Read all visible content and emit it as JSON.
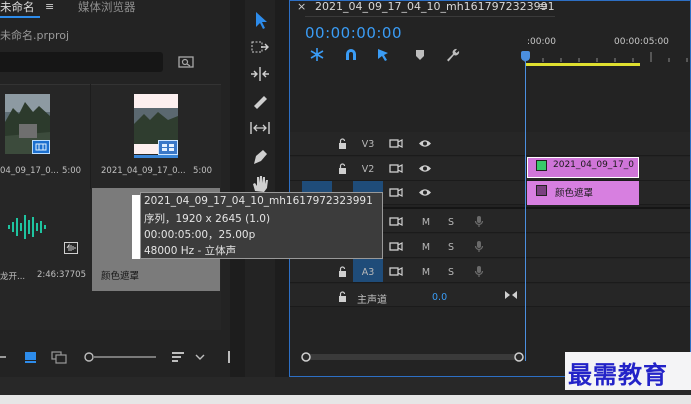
{
  "project_panel": {
    "tab_active": "未命名",
    "tab_menu_icon": "hamburger-icon",
    "tab_media": "媒体浏览器",
    "project_file": "未命名.prproj",
    "items": [
      {
        "name": "04_09_17_0...",
        "duration": "5:00"
      },
      {
        "name": "2021_04_09_17_0...",
        "duration": "5:00"
      },
      {
        "name": "龙开...",
        "duration": "2:46:37705"
      },
      {
        "name": "颜色遮罩",
        "duration": ""
      }
    ]
  },
  "tooltip": {
    "line1": "2021_04_09_17_04_10_mh1617972323991",
    "line2": "序列，1920 x 2645 (1.0)",
    "line3": "00:00:05:00，25.00p",
    "line4": "48000 Hz - 立体声"
  },
  "timeline": {
    "close_icon": "×",
    "sequence_name": "2021_04_09_17_04_10_mh1617972323991",
    "menu_icon": "≡",
    "timecode": "00:00:00:00",
    "ruler_start": ":00:00",
    "ruler_end": "00:00:05:00",
    "tracks": {
      "v3": "V3",
      "v2": "V2",
      "a3": "A3",
      "mute": "M",
      "solo": "S"
    },
    "clips": {
      "v2_clip": "2021_04_09_17_0",
      "v1_clip": "颜色遮罩"
    },
    "master_label": "主声道",
    "master_value": "0.0"
  },
  "watermark": "最需教育",
  "colors": {
    "accent": "#2d8ceb",
    "timecode": "#3a9cf5",
    "clip_pink": "#d77fe0",
    "work_area": "#e0e030"
  }
}
